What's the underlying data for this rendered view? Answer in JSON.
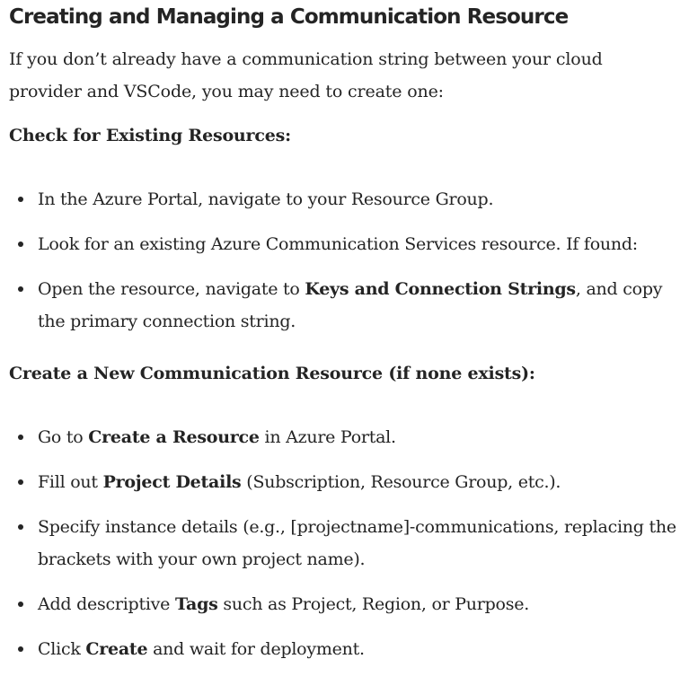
{
  "heading": "Creating and Managing a Communication Resource",
  "intro": "If you don’t already have a communication string between your cloud provider and VSCode, you may need to create one:",
  "section1": {
    "title": "Check for Existing Resources:",
    "items": [
      {
        "text": "In the Azure Portal, navigate to your Resource Group."
      },
      {
        "text": "Look for an existing Azure Communication Services resource. If found:"
      },
      {
        "pre": "Open the resource, navigate to ",
        "bold": "Keys and Connection Strings",
        "post": ", and copy the primary connection string."
      }
    ]
  },
  "section2": {
    "title": "Create a New Communication Resource (if none exists):",
    "items": [
      {
        "pre": "Go to ",
        "bold": "Create a Resource",
        "post": " in Azure Portal."
      },
      {
        "pre": "Fill out ",
        "bold": "Project Details",
        "post": " (Subscription, Resource Group, etc.)."
      },
      {
        "text": "Specify instance details (e.g., [projectname]-communications, replacing the brackets with your own project name)."
      },
      {
        "pre": "Add descriptive ",
        "bold": "Tags",
        "post": " such as Project, Region, or Purpose."
      },
      {
        "pre": "Click ",
        "bold": "Create",
        "post": " and wait for deployment."
      }
    ]
  }
}
